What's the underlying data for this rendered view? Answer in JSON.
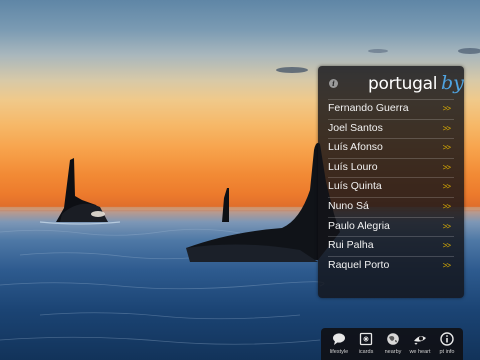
{
  "panel": {
    "info_icon": "info-icon",
    "logo": {
      "main": "portugal",
      "by": "by"
    },
    "rows": [
      {
        "name": "Fernando Guerra",
        "arrow": ">>"
      },
      {
        "name": "Joel Santos",
        "arrow": ">>"
      },
      {
        "name": "Luís Afonso",
        "arrow": ">>"
      },
      {
        "name": "Luís Louro",
        "arrow": ">>"
      },
      {
        "name": "Luís Quinta",
        "arrow": ">>"
      },
      {
        "name": "Nuno Sá",
        "arrow": ">>"
      },
      {
        "name": "Paulo Alegria",
        "arrow": ">>"
      },
      {
        "name": "Rui Palha",
        "arrow": ">>"
      },
      {
        "name": "Raquel Porto",
        "arrow": ">>"
      }
    ]
  },
  "toolbar": {
    "items": [
      {
        "label": "lifestyle",
        "icon": "speech-bubble-icon"
      },
      {
        "label": "icards",
        "icon": "card-icon"
      },
      {
        "label": "nearby",
        "icon": "globe-icon"
      },
      {
        "label": "we heart",
        "icon": "eye-heart-icon"
      },
      {
        "label": "pt info",
        "icon": "info-icon"
      }
    ]
  },
  "colors": {
    "arrow": "#e4b400",
    "logo_by": "#4fa3e0",
    "panel_bg": "#141418"
  }
}
